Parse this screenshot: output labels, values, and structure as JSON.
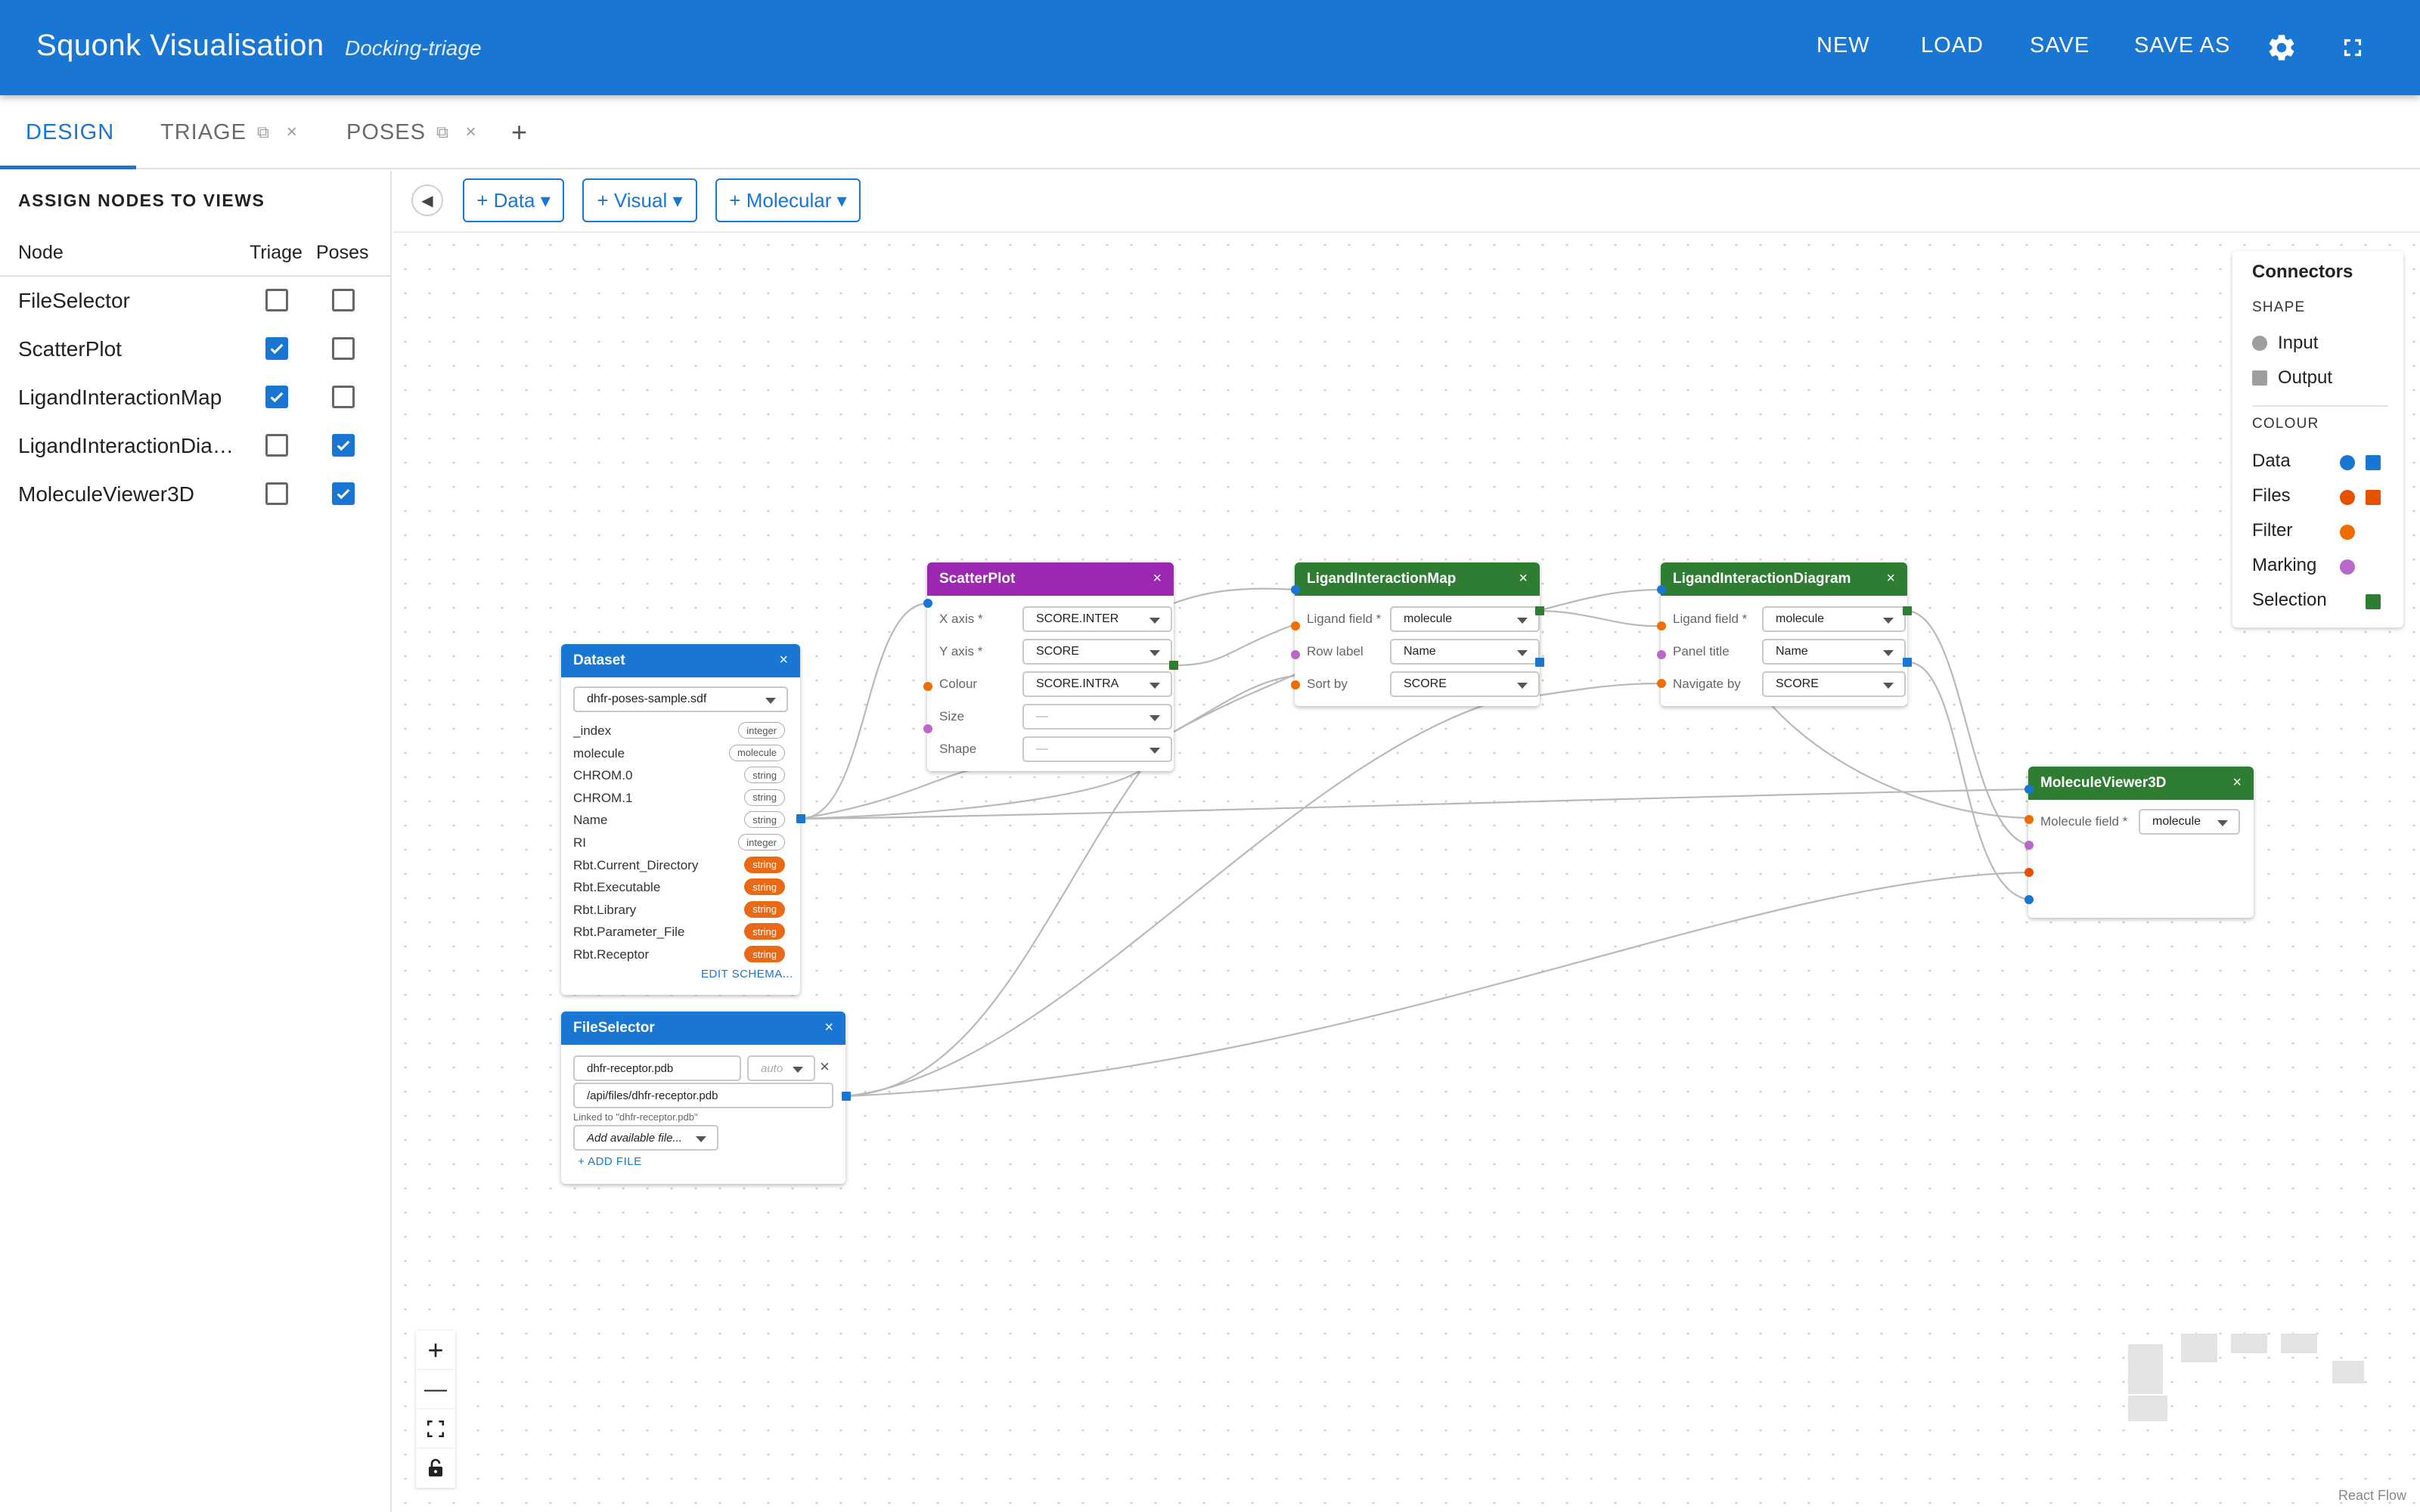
{
  "header": {
    "title": "Squonk Visualisation",
    "subtitle": "Docking-triage",
    "actions": {
      "new": "NEW",
      "load": "LOAD",
      "save": "SAVE",
      "save_as": "SAVE AS"
    }
  },
  "tabs": [
    {
      "label": "DESIGN",
      "active": true
    },
    {
      "label": "TRIAGE",
      "active": false
    },
    {
      "label": "POSES",
      "active": false
    }
  ],
  "tab_controls": {
    "copy_glyph": "⧉",
    "close_glyph": "×",
    "add_glyph": "+"
  },
  "assign_panel": {
    "title": "ASSIGN NODES TO VIEWS",
    "columns": {
      "node": "Node",
      "triage": "Triage",
      "poses": "Poses"
    },
    "rows": [
      {
        "name": "FileSelector",
        "triage": false,
        "poses": false
      },
      {
        "name": "ScatterPlot",
        "triage": true,
        "poses": false
      },
      {
        "name": "LigandInteractionMap",
        "triage": true,
        "poses": false
      },
      {
        "name": "LigandInteractionDiagram",
        "triage": false,
        "poses": true
      },
      {
        "name": "MoleculeViewer3D",
        "triage": false,
        "poses": true
      }
    ]
  },
  "toolbar": {
    "collapse_glyph": "◀",
    "data": "+ Data ▾",
    "visual": "+ Visual ▾",
    "molecular": "+ Molecular ▾"
  },
  "nodes": {
    "close_glyph": "×",
    "dataset": {
      "title": "Dataset",
      "file": "dhfr-poses-sample.sdf",
      "fields": [
        {
          "name": "_index",
          "type": "integer",
          "filled": false
        },
        {
          "name": "molecule",
          "type": "molecule",
          "filled": false
        },
        {
          "name": "CHROM.0",
          "type": "string",
          "filled": false
        },
        {
          "name": "CHROM.1",
          "type": "string",
          "filled": false
        },
        {
          "name": "Name",
          "type": "string",
          "filled": false
        },
        {
          "name": "RI",
          "type": "integer",
          "filled": false
        },
        {
          "name": "Rbt.Current_Directory",
          "type": "string",
          "filled": true
        },
        {
          "name": "Rbt.Executable",
          "type": "string",
          "filled": true
        },
        {
          "name": "Rbt.Library",
          "type": "string",
          "filled": true
        },
        {
          "name": "Rbt.Parameter_File",
          "type": "string",
          "filled": true
        },
        {
          "name": "Rbt.Receptor",
          "type": "string",
          "filled": true
        }
      ],
      "edit_schema": "EDIT SCHEMA..."
    },
    "scatter": {
      "title": "ScatterPlot",
      "fields": [
        {
          "label": "X axis *",
          "value": "SCORE.INTER",
          "muted": false
        },
        {
          "label": "Y axis *",
          "value": "SCORE",
          "muted": false
        },
        {
          "label": "Colour",
          "value": "SCORE.INTRA",
          "muted": false
        },
        {
          "label": "Size",
          "value": "—",
          "muted": true
        },
        {
          "label": "Shape",
          "value": "—",
          "muted": true
        }
      ]
    },
    "lim": {
      "title": "LigandInteractionMap",
      "fields": [
        {
          "label": "Ligand field *",
          "value": "molecule"
        },
        {
          "label": "Row label",
          "value": "Name"
        },
        {
          "label": "Sort by",
          "value": "SCORE"
        }
      ]
    },
    "lid": {
      "title": "LigandInteractionDiagram",
      "fields": [
        {
          "label": "Ligand field *",
          "value": "molecule"
        },
        {
          "label": "Panel title",
          "value": "Name"
        },
        {
          "label": "Navigate by",
          "value": "SCORE"
        }
      ]
    },
    "mv3d": {
      "title": "MoleculeViewer3D",
      "fields": [
        {
          "label": "Molecule field *",
          "value": "molecule"
        }
      ]
    },
    "file_selector": {
      "title": "FileSelector",
      "file_name": "dhfr-receptor.pdb",
      "format": "auto",
      "path": "/api/files/dhfr-receptor.pdb",
      "linked_note": "Linked to \"dhfr-receptor.pdb\"",
      "add_available": "Add available file...",
      "add_file": "+ ADD FILE"
    }
  },
  "legend": {
    "title": "Connectors",
    "shape_heading": "SHAPE",
    "input": "Input",
    "output": "Output",
    "colour_heading": "COLOUR",
    "colours": [
      {
        "label": "Data",
        "color": "#1976d2",
        "input": true,
        "output": true
      },
      {
        "label": "Files",
        "color": "#e65100",
        "input": true,
        "output": true
      },
      {
        "label": "Filter",
        "color": "#ef6c00",
        "input": true,
        "output": false
      },
      {
        "label": "Marking",
        "color": "#ba68c8",
        "input": true,
        "output": false
      },
      {
        "label": "Selection",
        "color": "#2e7d32",
        "input": false,
        "output": true
      }
    ]
  },
  "controls": {
    "zoom_in": "+",
    "zoom_out": "—"
  },
  "attribution": "React Flow",
  "colors": {
    "primary": "#1976d2",
    "visual_node": "#9c27b0",
    "molecular_node": "#2e7d32",
    "data_node": "#1976d2",
    "string_pill": "#e86a17"
  }
}
